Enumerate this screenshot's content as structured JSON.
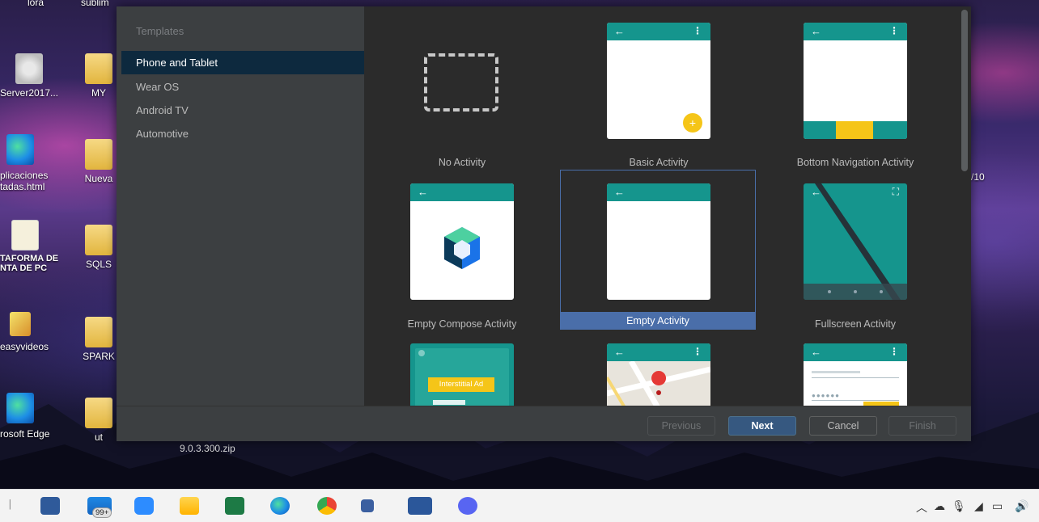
{
  "desktop": {
    "top_labels": [
      "lora",
      "sublim"
    ],
    "icons": [
      {
        "label": "Server2017...",
        "kind": "disc"
      },
      {
        "label": "MY",
        "kind": "folder"
      },
      {
        "label": "plicaciones\ntadas.html",
        "kind": "edge"
      },
      {
        "label": "Nueva",
        "kind": "folder"
      },
      {
        "label": "TAFORMA DE\nNTA DE PC",
        "kind": "file"
      },
      {
        "label": "SQLS",
        "kind": "folder"
      },
      {
        "label": "easyvideos",
        "kind": "image"
      },
      {
        "label": "SPARK",
        "kind": "folder"
      },
      {
        "label": "rosoft Edge",
        "kind": "edge"
      },
      {
        "label": "ut",
        "kind": "folder"
      }
    ],
    "right_clip_text": "/10",
    "behind_dialog_text": "9.0.3.300.zip"
  },
  "dialog": {
    "sidebar": {
      "title": "Templates",
      "items": [
        {
          "label": "Phone and Tablet",
          "selected": true
        },
        {
          "label": "Wear OS",
          "selected": false
        },
        {
          "label": "Android TV",
          "selected": false
        },
        {
          "label": "Automotive",
          "selected": false
        }
      ]
    },
    "templates": [
      {
        "label": "No Activity"
      },
      {
        "label": "Basic Activity"
      },
      {
        "label": "Bottom Navigation Activity"
      },
      {
        "label": "Empty Compose Activity"
      },
      {
        "label": "Empty Activity",
        "selected": true
      },
      {
        "label": "Fullscreen Activity"
      },
      {
        "label": "",
        "preview_text": "Interstitial Ad"
      },
      {
        "label": ""
      },
      {
        "label": ""
      }
    ],
    "buttons": {
      "previous": "Previous",
      "next": "Next",
      "cancel": "Cancel",
      "finish": "Finish"
    },
    "colors": {
      "accent": "#15958d",
      "selection": "#4a6ea9",
      "fab": "#f5c518"
    }
  },
  "taskbar": {
    "mail_badge": "99+",
    "apps": [
      "vscode-icon",
      "mail-icon",
      "zoom-icon",
      "file-explorer-icon",
      "excel-icon",
      "edge-icon",
      "chrome-icon",
      "android-studio-icon",
      "word-icon",
      "discord-icon"
    ],
    "tray_icons": [
      "chevron-up-icon",
      "cloud-icon",
      "mic-icon",
      "wifi-icon",
      "battery-icon",
      "volume-icon"
    ]
  }
}
